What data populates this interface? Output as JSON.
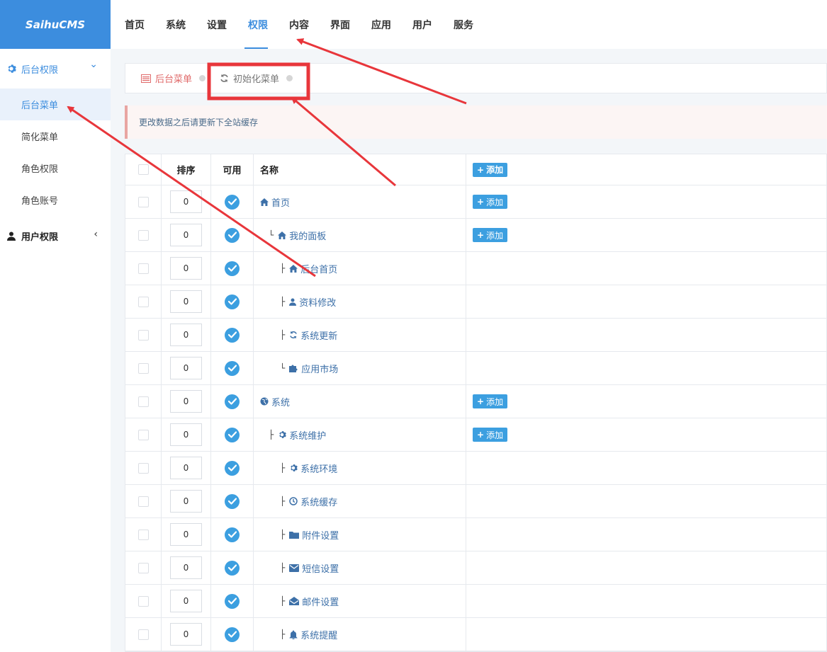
{
  "app": {
    "logo": "SaihuCMS"
  },
  "topnav": [
    "首页",
    "系统",
    "设置",
    "权限",
    "内容",
    "界面",
    "应用",
    "用户",
    "服务"
  ],
  "sidebar": {
    "group1": "后台权限",
    "items": [
      "后台菜单",
      "简化菜单",
      "角色权限",
      "角色账号"
    ],
    "group2": "用户权限"
  },
  "tabs": {
    "tab1": "后台菜单",
    "tab2": "初始化菜单"
  },
  "alert": "更改数据之后请更新下全站缓存",
  "table": {
    "headers": {
      "sort": "排序",
      "use": "可用",
      "name": "名称"
    },
    "add_label": "添加",
    "rows": [
      {
        "sort": "0",
        "prefix": "",
        "name": "首页",
        "icon": "home-icon",
        "add": true
      },
      {
        "sort": "0",
        "prefix": "└",
        "name": "我的面板",
        "icon": "home-icon",
        "add": true
      },
      {
        "sort": "0",
        "prefix": "├",
        "name": "后台首页",
        "icon": "home-icon",
        "add": false
      },
      {
        "sort": "0",
        "prefix": "├",
        "name": "资料修改",
        "icon": "user-icon",
        "add": false
      },
      {
        "sort": "0",
        "prefix": "├",
        "name": "系统更新",
        "icon": "refresh-icon",
        "add": false
      },
      {
        "sort": "0",
        "prefix": "└",
        "name": "应用市场",
        "icon": "puzzle-icon",
        "add": false
      },
      {
        "sort": "0",
        "prefix": "",
        "name": "系统",
        "icon": "globe-icon",
        "add": true
      },
      {
        "sort": "0",
        "prefix": "├",
        "name": "系统维护",
        "icon": "gear-icon",
        "add": true
      },
      {
        "sort": "0",
        "prefix": "├",
        "name": "系统环境",
        "icon": "gear-icon",
        "add": false
      },
      {
        "sort": "0",
        "prefix": "├",
        "name": "系统缓存",
        "icon": "clock-icon",
        "add": false
      },
      {
        "sort": "0",
        "prefix": "├",
        "name": "附件设置",
        "icon": "folder-icon",
        "add": false
      },
      {
        "sort": "0",
        "prefix": "├",
        "name": "短信设置",
        "icon": "envelope-icon",
        "add": false
      },
      {
        "sort": "0",
        "prefix": "├",
        "name": "邮件设置",
        "icon": "envelope-open-icon",
        "add": false
      },
      {
        "sort": "0",
        "prefix": "├",
        "name": "系统提醒",
        "icon": "bell-icon",
        "add": false
      }
    ]
  },
  "colors": {
    "accent": "#3c8dde",
    "annotation": "#e8363b"
  }
}
